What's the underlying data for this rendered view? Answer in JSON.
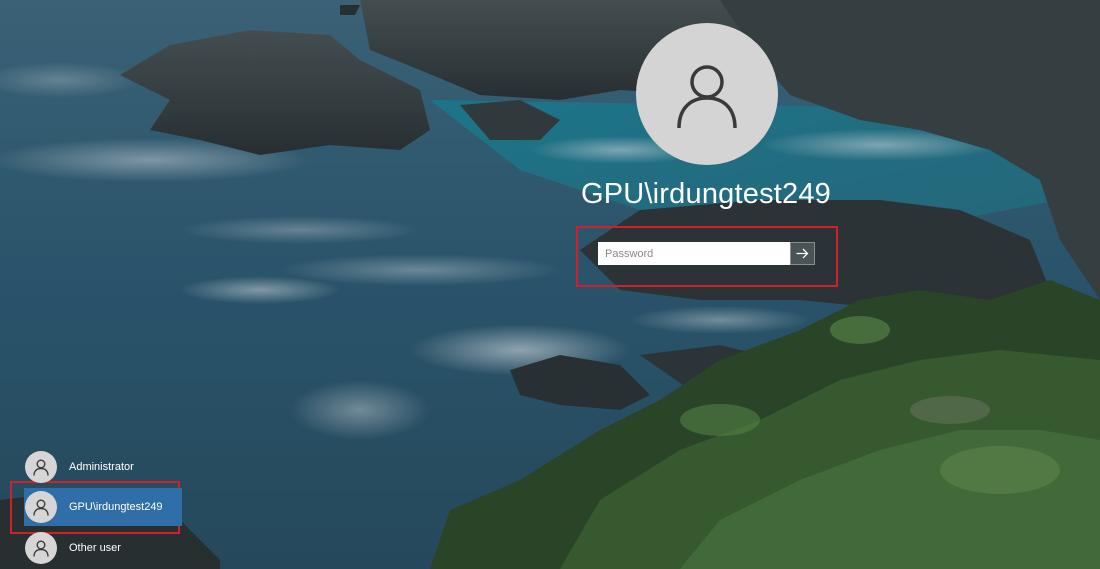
{
  "login": {
    "username": "GPU\\irdungtest249",
    "password_placeholder": "Password",
    "password_value": "",
    "avatar_icon": "user-icon",
    "submit_icon": "arrow-right-icon"
  },
  "user_list": {
    "items": [
      {
        "label": "Administrator",
        "icon": "user-icon",
        "selected": false
      },
      {
        "label": "GPU\\irdungtest249",
        "icon": "user-icon",
        "selected": true
      },
      {
        "label": "Other user",
        "icon": "user-icon",
        "selected": false
      }
    ]
  },
  "colors": {
    "highlight": "#d0202a",
    "selected_user": "#2f6ea6",
    "avatar_bg": "#d4d4d4"
  }
}
